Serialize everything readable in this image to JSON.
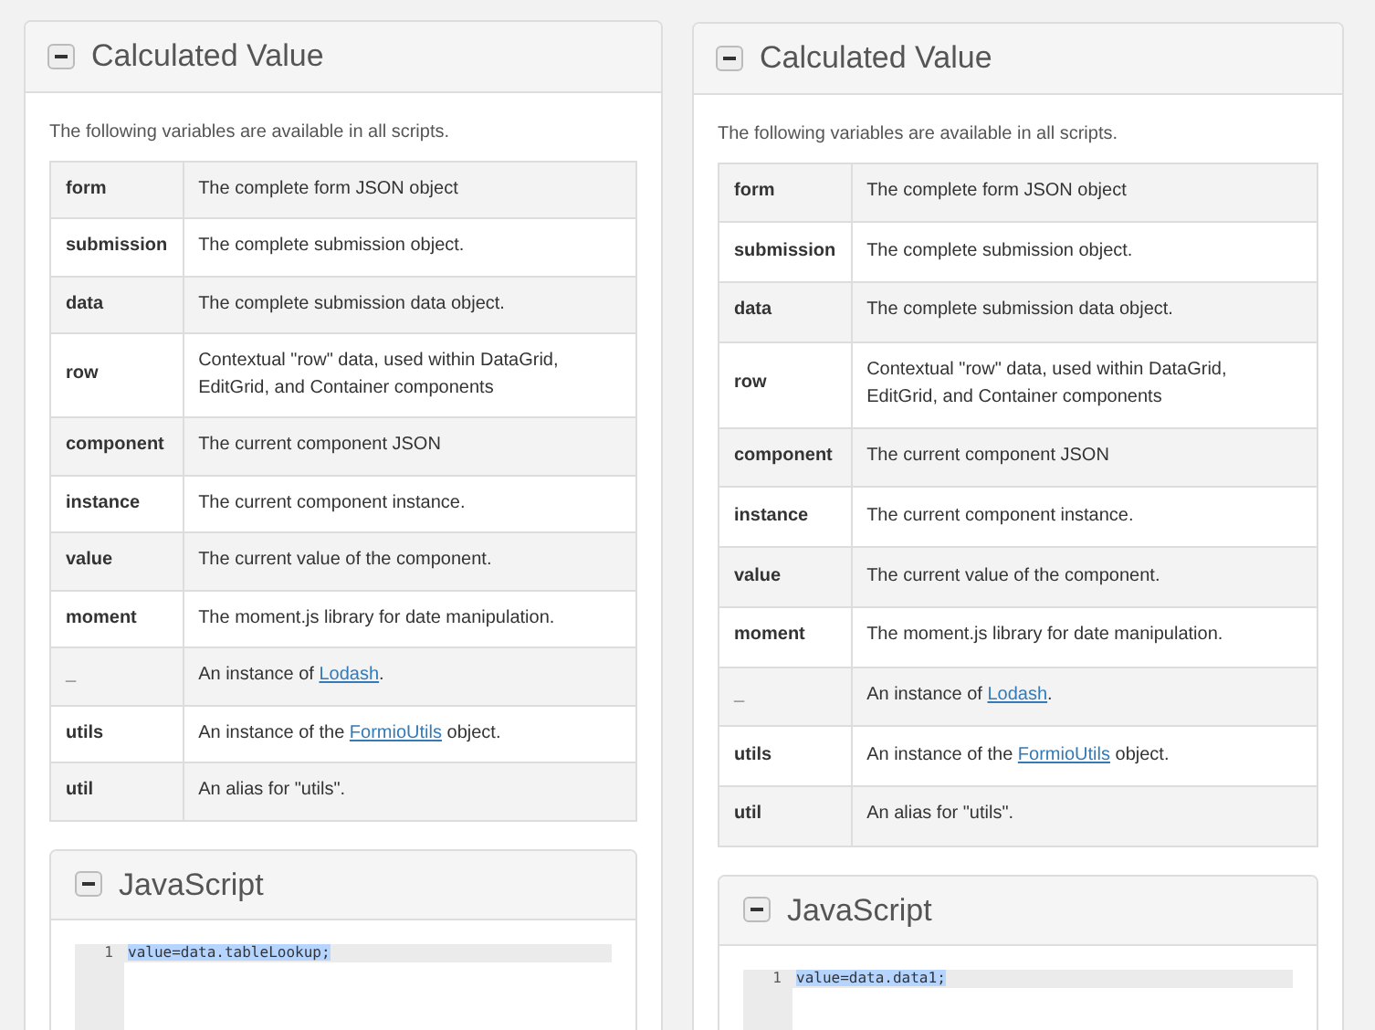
{
  "panels": [
    {
      "title": "Calculated Value",
      "intro": "The following variables are available in all scripts.",
      "rows": [
        {
          "name": "form",
          "description": [
            {
              "kind": "text",
              "text": "The complete form JSON object"
            }
          ]
        },
        {
          "name": "submission",
          "description": [
            {
              "kind": "text",
              "text": "The complete submission object."
            }
          ]
        },
        {
          "name": "data",
          "description": [
            {
              "kind": "text",
              "text": "The complete submission data object."
            }
          ]
        },
        {
          "name": "row",
          "description": [
            {
              "kind": "text",
              "text": "Contextual \"row\" data, used within DataGrid, EditGrid, and Container components"
            }
          ]
        },
        {
          "name": "component",
          "description": [
            {
              "kind": "text",
              "text": "The current component JSON"
            }
          ]
        },
        {
          "name": "instance",
          "description": [
            {
              "kind": "text",
              "text": "The current component instance."
            }
          ]
        },
        {
          "name": "value",
          "description": [
            {
              "kind": "text",
              "text": "The current value of the component."
            }
          ]
        },
        {
          "name": "moment",
          "description": [
            {
              "kind": "text",
              "text": "The moment.js library for date manipulation."
            }
          ]
        },
        {
          "name": "_",
          "description": [
            {
              "kind": "text",
              "text": "An instance of "
            },
            {
              "kind": "link",
              "text": "Lodash"
            },
            {
              "kind": "text",
              "text": "."
            }
          ]
        },
        {
          "name": "utils",
          "description": [
            {
              "kind": "text",
              "text": "An instance of the "
            },
            {
              "kind": "link",
              "text": "FormioUtils"
            },
            {
              "kind": "text",
              "text": " object."
            }
          ]
        },
        {
          "name": "util",
          "description": [
            {
              "kind": "text",
              "text": "An alias for \"utils\"."
            }
          ]
        }
      ],
      "editor": {
        "title": "JavaScript",
        "lines": [
          {
            "number": "1",
            "code": "value=data.tableLookup;",
            "highlighted": true
          }
        ]
      }
    },
    {
      "title": "Calculated Value",
      "intro": "The following variables are available in all scripts.",
      "rows": [
        {
          "name": "form",
          "description": [
            {
              "kind": "text",
              "text": "The complete form JSON object"
            }
          ]
        },
        {
          "name": "submission",
          "description": [
            {
              "kind": "text",
              "text": "The complete submission object."
            }
          ]
        },
        {
          "name": "data",
          "description": [
            {
              "kind": "text",
              "text": "The complete submission data object."
            }
          ]
        },
        {
          "name": "row",
          "description": [
            {
              "kind": "text",
              "text": "Contextual \"row\" data, used within DataGrid, EditGrid, and Container components"
            }
          ]
        },
        {
          "name": "component",
          "description": [
            {
              "kind": "text",
              "text": "The current component JSON"
            }
          ]
        },
        {
          "name": "instance",
          "description": [
            {
              "kind": "text",
              "text": "The current component instance."
            }
          ]
        },
        {
          "name": "value",
          "description": [
            {
              "kind": "text",
              "text": "The current value of the component."
            }
          ]
        },
        {
          "name": "moment",
          "description": [
            {
              "kind": "text",
              "text": "The moment.js library for date manipulation."
            }
          ]
        },
        {
          "name": "_",
          "description": [
            {
              "kind": "text",
              "text": "An instance of "
            },
            {
              "kind": "link",
              "text": "Lodash"
            },
            {
              "kind": "text",
              "text": "."
            }
          ]
        },
        {
          "name": "utils",
          "description": [
            {
              "kind": "text",
              "text": "An instance of the "
            },
            {
              "kind": "link",
              "text": "FormioUtils"
            },
            {
              "kind": "text",
              "text": " object."
            }
          ]
        },
        {
          "name": "util",
          "description": [
            {
              "kind": "text",
              "text": "An alias for \"utils\"."
            }
          ]
        }
      ],
      "editor": {
        "title": "JavaScript",
        "lines": [
          {
            "number": "1",
            "code": "value=data.data1;",
            "highlighted": true
          }
        ]
      }
    }
  ]
}
